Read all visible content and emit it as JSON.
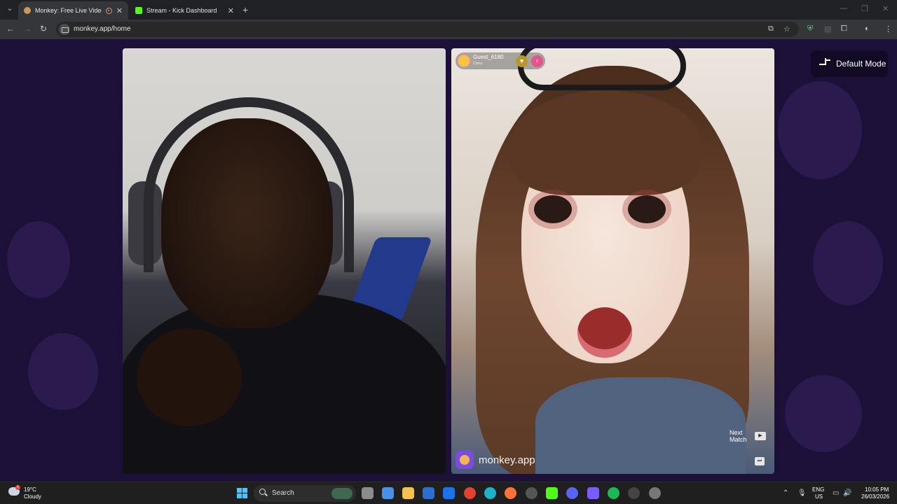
{
  "browser": {
    "tabs": [
      {
        "title": "Monkey: Free Live Video Ch",
        "active": true
      },
      {
        "title": "Stream - Kick Dashboard",
        "active": false
      }
    ],
    "url": "monkey.app/home"
  },
  "page": {
    "mode_button": "Default Mode",
    "remote_user": {
      "name": "Guest_6180",
      "country": "China"
    },
    "brand": "monkey.app",
    "next_match": "Next Match"
  },
  "taskbar": {
    "weather": {
      "temp": "19°C",
      "condition": "Cloudy",
      "alert": "1"
    },
    "search_placeholder": "Search",
    "language": "ENG",
    "region": "US",
    "time": "10:05 PM",
    "date": "26/03/2026"
  },
  "colors": {
    "page_background": "#1d1038",
    "brand_purple": "#7a4de0",
    "tab_active": "#35363a"
  }
}
